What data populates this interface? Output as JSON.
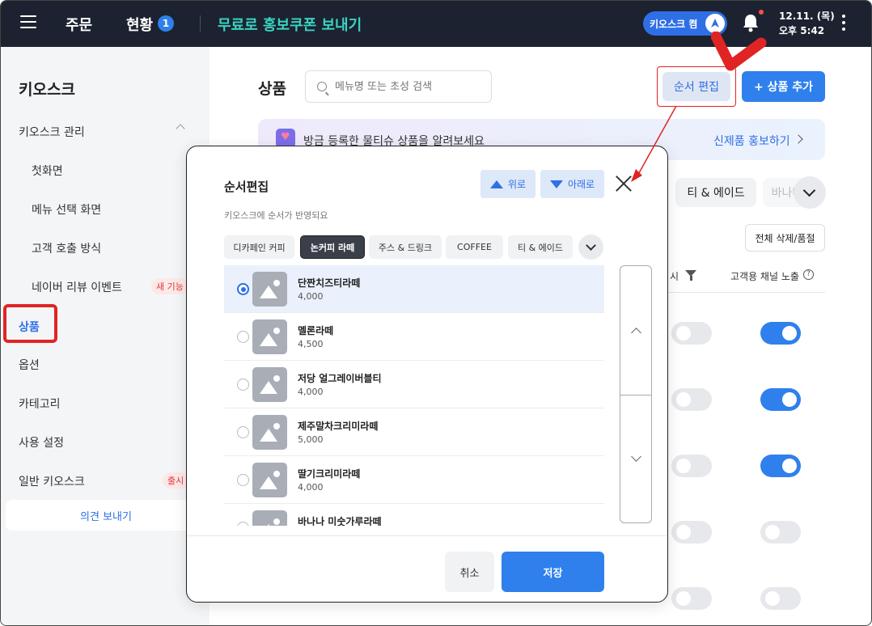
{
  "topbar": {
    "order": "주문",
    "status": "현황",
    "status_badge": "1",
    "promo": "무료로 홍보쿠폰 보내기",
    "kiosk_toggle": "키오스크 켬",
    "date": "12.11. (목)",
    "time": "오후 5:42"
  },
  "sidebar": {
    "title": "키오스크",
    "items": [
      {
        "label": "키오스크 관리"
      },
      {
        "label": "첫화면"
      },
      {
        "label": "메뉴 선택 화면"
      },
      {
        "label": "고객 호출 방식"
      },
      {
        "label": "네이버 리뷰 이벤트",
        "badge": "새 기능"
      },
      {
        "label": "상품"
      },
      {
        "label": "옵션"
      },
      {
        "label": "카테고리"
      },
      {
        "label": "사용 설정"
      },
      {
        "label": "일반 키오스크",
        "badge": "출시"
      }
    ],
    "feedback": "의견 보내기"
  },
  "main": {
    "title": "상품",
    "search_placeholder": "메뉴명 또는 초성 검색",
    "order_edit": "순서 편집",
    "add_product": "+ 상품 추가",
    "banner_text": "방금 등록한 물티슈 상품을 알려보세요",
    "banner_link": "신제품 홍보하기",
    "tabs_visible": [
      "티 & 에이드",
      "바나나"
    ],
    "delete_btn": "전체 삭제/품절",
    "col_display": "시",
    "col_channel": "고객용 채널 노출",
    "toggles": [
      {
        "display": false,
        "channel": true
      },
      {
        "display": false,
        "channel": true
      },
      {
        "display": false,
        "channel": true
      },
      {
        "display": false,
        "channel": false
      },
      {
        "display": false,
        "channel": false
      }
    ]
  },
  "modal": {
    "title": "순서편집",
    "subtitle": "키오스크에 순서가 반영되요",
    "up": "위로",
    "down": "아래로",
    "tabs": [
      {
        "label": "디카페인 커피",
        "active": false
      },
      {
        "label": "논커피 라떼",
        "active": true
      },
      {
        "label": "주스 & 드링크",
        "active": false
      },
      {
        "label": "COFFEE",
        "active": false
      },
      {
        "label": "티 & 에이드",
        "active": false
      }
    ],
    "products": [
      {
        "name": "단짠치즈티라떼",
        "price": "4,000",
        "selected": true
      },
      {
        "name": "멜론라떼",
        "price": "4,500",
        "selected": false
      },
      {
        "name": "저당 얼그레이버블티",
        "price": "4,000",
        "selected": false
      },
      {
        "name": "제주말차크리미라떼",
        "price": "5,000",
        "selected": false
      },
      {
        "name": "딸기크리미라떼",
        "price": "4,000",
        "selected": false
      },
      {
        "name": "바나나 미숫가루라떼",
        "price": "",
        "selected": false
      }
    ],
    "cancel": "취소",
    "save": "저장"
  },
  "colors": {
    "accent": "#2f80ed",
    "topbar": "#1c2230",
    "promo": "#39d4c2",
    "highlight": "#e02424"
  }
}
